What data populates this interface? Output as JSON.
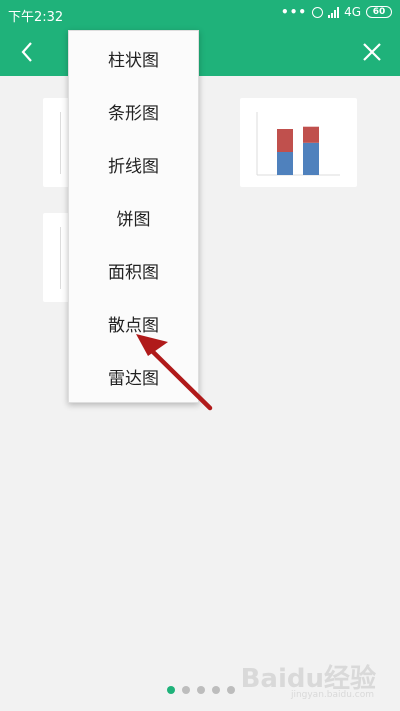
{
  "statusbar": {
    "time": "下午2:32",
    "more": "•••",
    "network": "4G",
    "battery": "60"
  },
  "header": {
    "back_icon": "chevron-left-icon",
    "close_icon": "close-icon"
  },
  "dropdown": {
    "items": [
      "柱状图",
      "条形图",
      "折线图",
      "饼图",
      "面积图",
      "散点图",
      "雷达图"
    ]
  },
  "thumbnail_chart": {
    "bars": [
      {
        "bottom": 1.0,
        "top": 1.0
      },
      {
        "bottom": 1.4,
        "top": 0.7
      }
    ],
    "colors": {
      "bottom": "#4f81bd",
      "top": "#c0504d"
    }
  },
  "pager": {
    "count": 5,
    "active": 0
  },
  "watermark": {
    "text": "Baidu经验",
    "sub": "jingyan.baidu.com"
  },
  "colors": {
    "accent": "#1fb27a",
    "arrow": "#b01a1a"
  }
}
